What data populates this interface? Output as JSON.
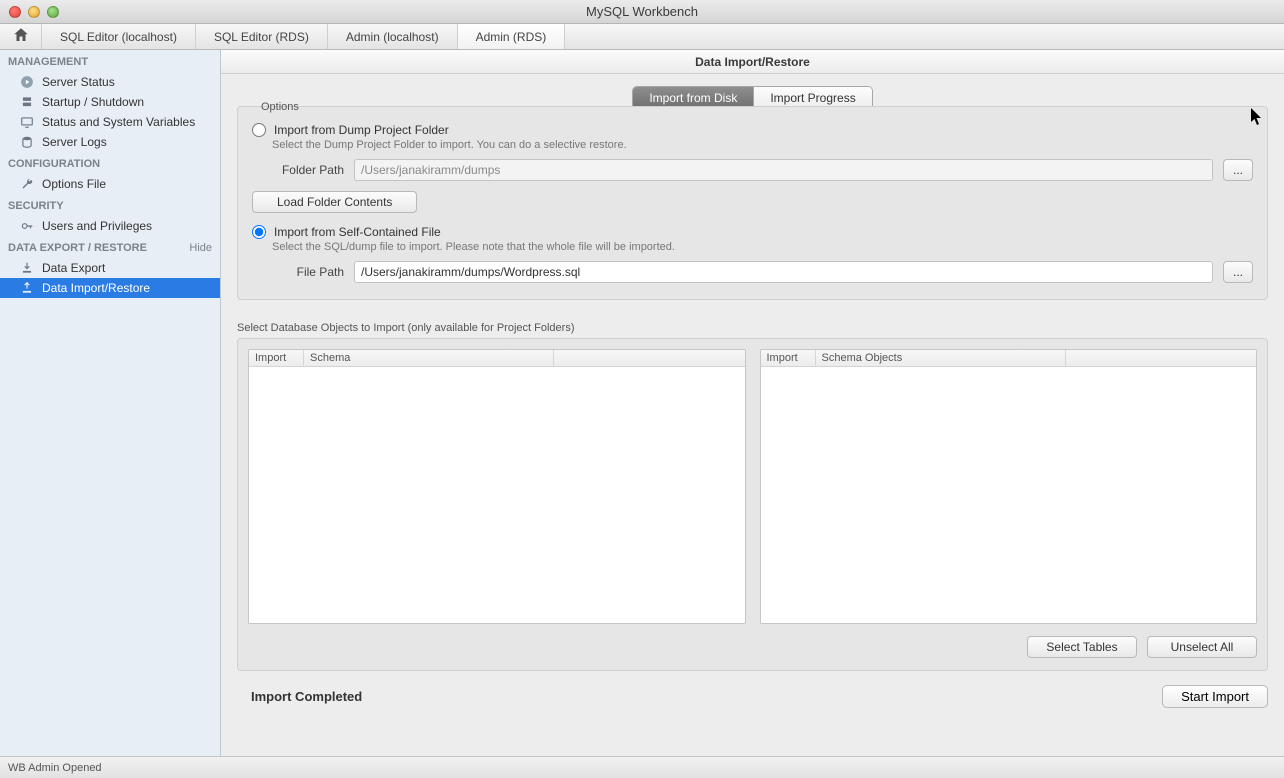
{
  "window": {
    "title": "MySQL Workbench"
  },
  "conn_tabs": {
    "items": [
      "SQL Editor (localhost)",
      "SQL Editor (RDS)",
      "Admin (localhost)",
      "Admin (RDS)"
    ],
    "active_index": 3
  },
  "sidebar": {
    "sections": {
      "management": {
        "title": "MANAGEMENT",
        "items": [
          "Server Status",
          "Startup / Shutdown",
          "Status and System Variables",
          "Server Logs"
        ]
      },
      "configuration": {
        "title": "CONFIGURATION",
        "items": [
          "Options File"
        ]
      },
      "security": {
        "title": "SECURITY",
        "items": [
          "Users and Privileges"
        ]
      },
      "data": {
        "title": "DATA EXPORT / RESTORE",
        "hide": "Hide",
        "items": [
          "Data Export",
          "Data Import/Restore"
        ],
        "selected_index": 1
      }
    }
  },
  "page": {
    "title": "Data Import/Restore"
  },
  "tabs": {
    "import_from_disk": "Import from Disk",
    "import_progress": "Import Progress"
  },
  "options": {
    "group_label": "Options",
    "dump_folder": {
      "label": "Import from Dump Project Folder",
      "hint": "Select the Dump Project Folder to import. You can do a selective restore.",
      "path_label": "Folder Path",
      "path_value": "/Users/janakiramm/dumps",
      "load_btn": "Load Folder Contents"
    },
    "self_contained": {
      "label": "Import from Self-Contained File",
      "hint": "Select the SQL/dump file to import. Please note that the whole file will be imported.",
      "path_label": "File Path",
      "path_value": "/Users/janakiramm/dumps/Wordpress.sql"
    },
    "browse": "..."
  },
  "objects": {
    "group_label": "Select Database Objects to Import (only available for Project Folders)",
    "left_headers": [
      "Import",
      "Schema"
    ],
    "right_headers": [
      "Import",
      "Schema Objects"
    ],
    "select_tables": "Select Tables",
    "unselect_all": "Unselect All"
  },
  "footer": {
    "status": "Import Completed",
    "start": "Start Import"
  },
  "statusbar": "WB Admin Opened"
}
